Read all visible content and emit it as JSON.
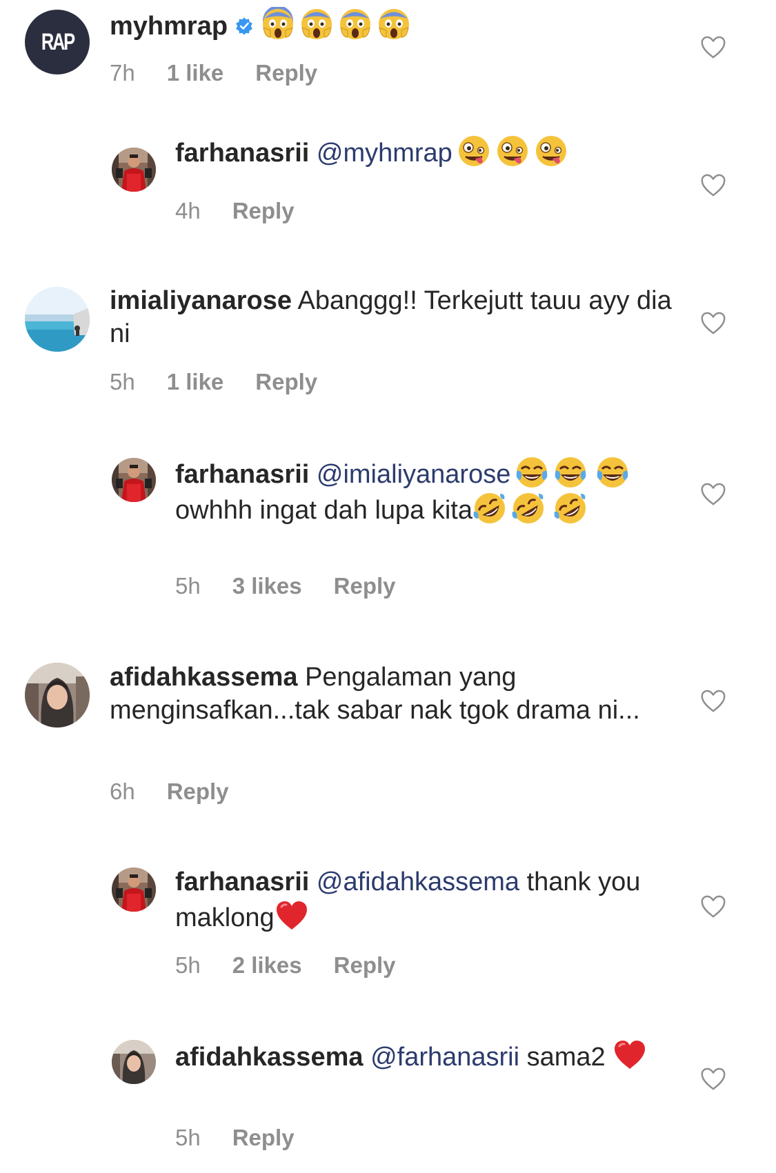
{
  "colors": {
    "username": "#262626",
    "mention": "#2c3b6e",
    "meta": "#8e8e8e",
    "verified": "#3897f0",
    "heart_outline": "#8e8e8e"
  },
  "comments": [
    {
      "username": "myhmrap",
      "verified": true,
      "avatar_text": "RAP",
      "text": "",
      "emojis": [
        "scream-emoji",
        "scream-emoji",
        "scream-emoji",
        "scream-emoji"
      ],
      "time": "7h",
      "likes": "1 like",
      "reply": "Reply"
    },
    {
      "username": "farhanasrii",
      "mention": "@myhmrap",
      "text": "",
      "emojis": [
        "zany-face-emoji",
        "zany-face-emoji",
        "zany-face-emoji"
      ],
      "time": "4h",
      "reply": "Reply"
    },
    {
      "username": "imialiyanarose",
      "text": "Abanggg!! Terkejutt tauu ayy dia ni",
      "time": "5h",
      "likes": "1 like",
      "reply": "Reply"
    },
    {
      "username": "farhanasrii",
      "mention": "@imialiyanarose",
      "text_a": "owhhh ingat dah lupa kita",
      "emojis_a": [
        "joy-emoji",
        "joy-emoji",
        "joy-emoji"
      ],
      "emojis_b": [
        "rofl-emoji",
        "rofl-emoji",
        "rofl-emoji"
      ],
      "time": "5h",
      "likes": "3 likes",
      "reply": "Reply"
    },
    {
      "username": "afidahkassema",
      "text": "Pengalaman yang menginsafkan...tak sabar nak tgok drama ni...",
      "time": "6h",
      "reply": "Reply"
    },
    {
      "username": "farhanasrii",
      "mention": "@afidahkassema",
      "text": "thank you maklong",
      "emojis": [
        "red-heart-emoji"
      ],
      "time": "5h",
      "likes": "2 likes",
      "reply": "Reply"
    },
    {
      "username": "afidahkassema",
      "mention": "@farhanasrii",
      "text": "sama2",
      "emojis": [
        "red-heart-emoji"
      ],
      "time": "5h",
      "reply": "Reply"
    }
  ]
}
